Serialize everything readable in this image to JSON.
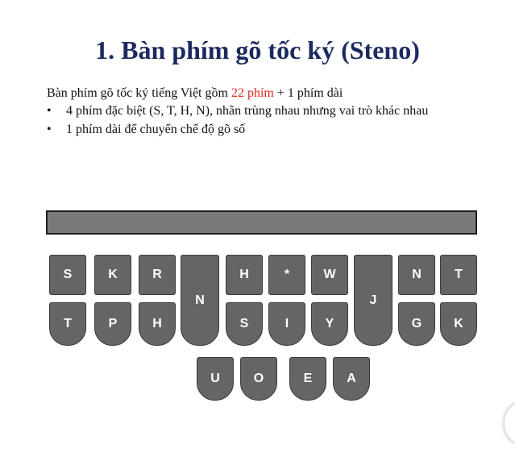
{
  "slide": {
    "title": "1. Bàn phím gõ tốc ký (Steno)",
    "intro_before": "Bàn phím gõ tốc ký tiếng Việt gồm ",
    "intro_highlight": "22 phím",
    "intro_after": " + 1 phím dài",
    "bullet_symbol": "•",
    "bullets": [
      "4 phím đặc biệt (S, T, H, N), nhãn trùng nhau nhưng vai trò khác nhau",
      "1 phím dài để chuyển chế độ gõ số"
    ],
    "highlight_color": "#e0261f",
    "title_color": "#1b2a5e"
  },
  "keyboard": {
    "key_color": "#656565",
    "top_row": [
      "S",
      "K",
      "R",
      "H",
      "*",
      "W",
      "N",
      "T"
    ],
    "bottom_row": [
      "T",
      "P",
      "H",
      "S",
      "I",
      "Y",
      "G",
      "K"
    ],
    "tall_keys": [
      "N",
      "J"
    ],
    "vowels": [
      "U",
      "O",
      "E",
      "A"
    ]
  }
}
